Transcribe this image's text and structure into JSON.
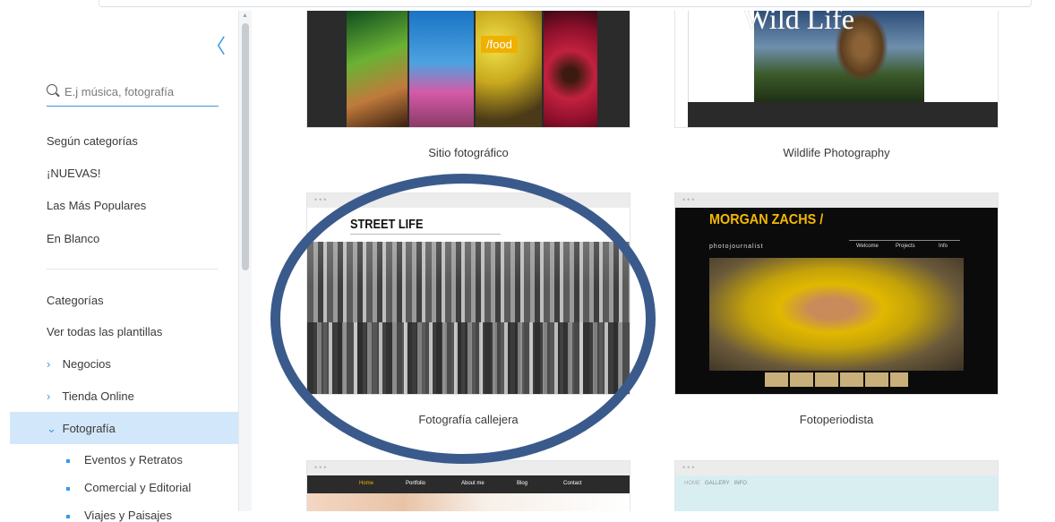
{
  "sidebar": {
    "collapse_icon": "chevron-left-icon",
    "search_placeholder": "E.j música, fotografía",
    "links": [
      "Según categorías",
      "¡NUEVAS!",
      "Las Más Populares",
      "En Blanco"
    ],
    "section_title": "Categorías",
    "all_templates": "Ver todas las plantillas",
    "categories": [
      {
        "label": "Negocios",
        "expanded": false
      },
      {
        "label": "Tienda Online",
        "expanded": false
      },
      {
        "label": "Fotografía",
        "expanded": true,
        "selected": true
      }
    ],
    "subcategories": [
      "Eventos y Retratos",
      "Comercial y Editorial",
      "Viajes y Paisajes"
    ]
  },
  "templates": [
    {
      "label": "Sitio fotográfico",
      "thumb_text": "/food"
    },
    {
      "label": "Wildlife Photography",
      "thumb_text": "Wild Life"
    },
    {
      "label": "Fotografía callejera",
      "thumb_text": "STREET LIFE"
    },
    {
      "label": "Fotoperiodista",
      "thumb_text": "MORGAN ZACHS /",
      "thumb_subtitle": "photojournalist",
      "thumb_nav": [
        "Welcome",
        "Projects",
        "Info"
      ]
    },
    {
      "label": "",
      "thumb_nav": [
        "Home",
        "Portfolio",
        "About me",
        "Blog",
        "Contact"
      ]
    },
    {
      "label": "",
      "thumb_nav": [
        "HOME",
        "GALLERY",
        "INFO"
      ]
    }
  ],
  "colors": {
    "accent": "#3899ec",
    "selected_bg": "#d3e7fa",
    "highlight_ellipse": "#3a5a8c",
    "food_tag": "#f0b000",
    "morgan_brand": "#f5b800"
  }
}
